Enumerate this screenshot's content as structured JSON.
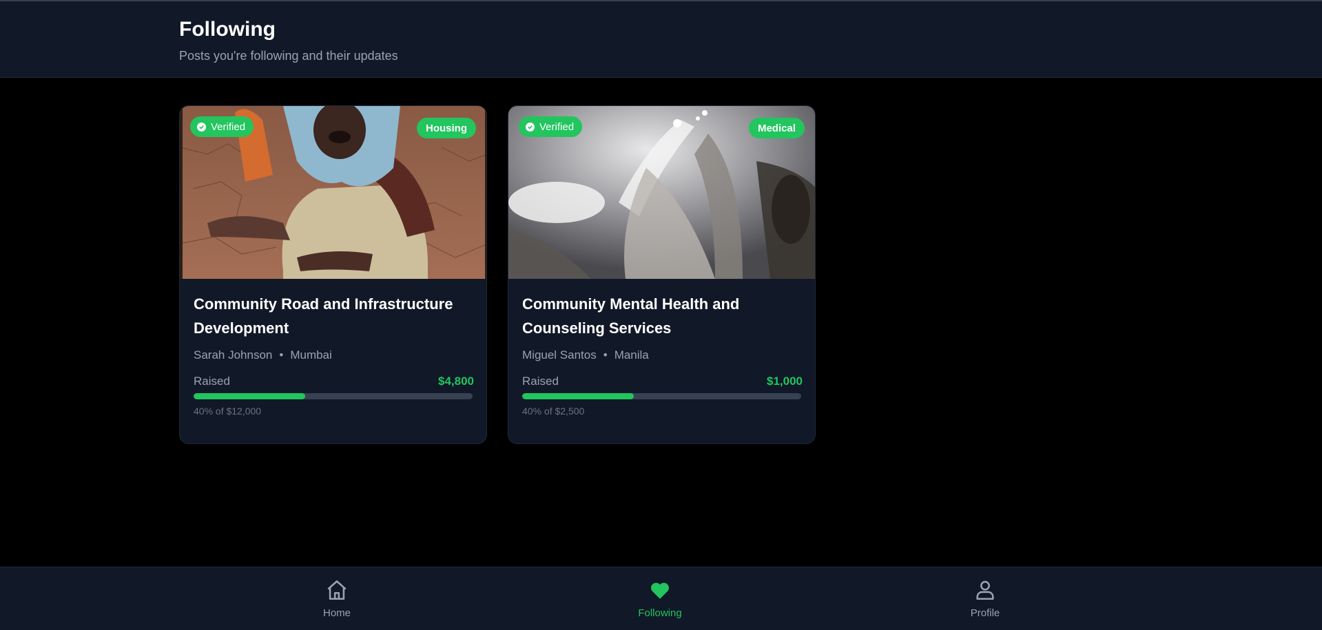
{
  "header": {
    "title": "Following",
    "subtitle": "Posts you're following and their updates"
  },
  "posts": [
    {
      "verified_label": "Verified",
      "category": "Housing",
      "title": "Community Road and Infrastructure Development",
      "author": "Sarah Johnson",
      "separator": "•",
      "location": "Mumbai",
      "raised_label": "Raised",
      "raised_amount": "$4,800",
      "progress_percent": 40,
      "progress_text": "40% of $12,000"
    },
    {
      "verified_label": "Verified",
      "category": "Medical",
      "title": "Community Mental Health and Counseling Services",
      "author": "Miguel Santos",
      "separator": "•",
      "location": "Manila",
      "raised_label": "Raised",
      "raised_amount": "$1,000",
      "progress_percent": 40,
      "progress_text": "40% of $2,500"
    }
  ],
  "nav": {
    "home": {
      "label": "Home",
      "icon": "home-icon",
      "active": false
    },
    "following": {
      "label": "Following",
      "icon": "heart-icon",
      "active": true
    },
    "profile": {
      "label": "Profile",
      "icon": "user-icon",
      "active": false
    }
  },
  "colors": {
    "accent": "#22c55e",
    "surface": "#111827",
    "background": "#000000",
    "muted_text": "#9ca3af"
  }
}
